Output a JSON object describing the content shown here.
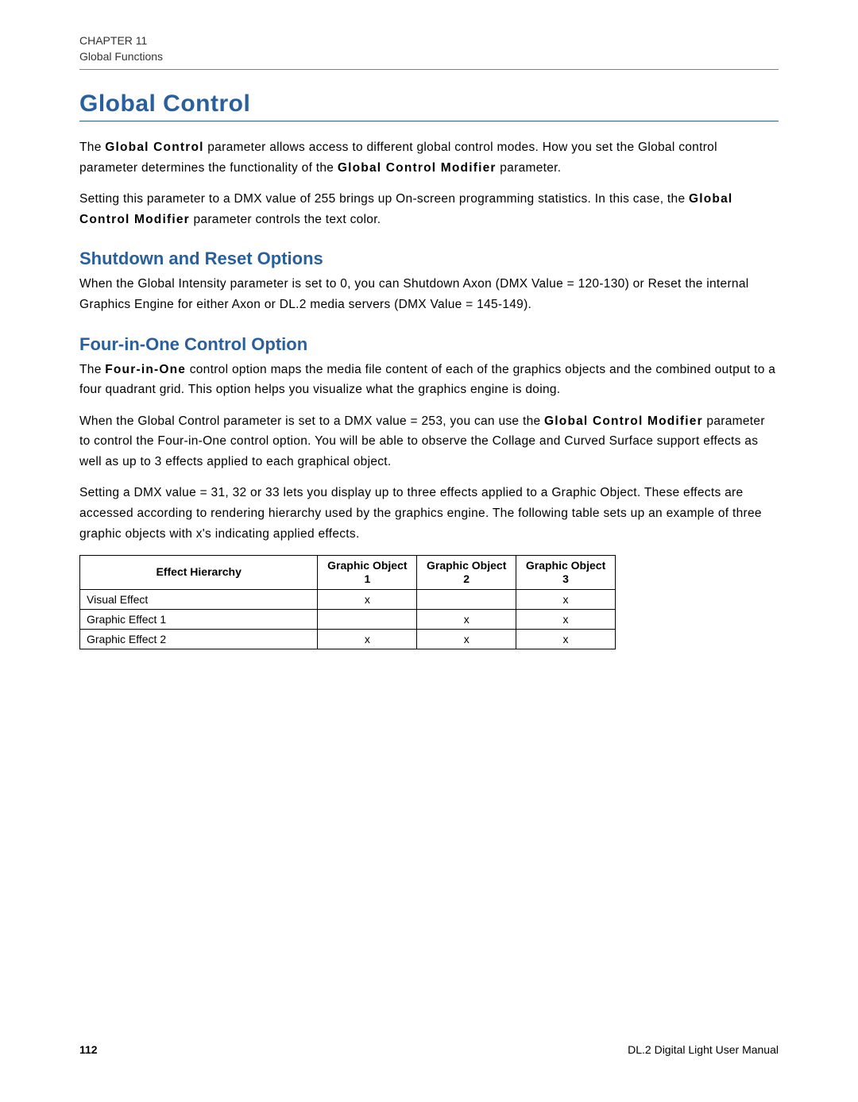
{
  "header": {
    "chapter": "CHAPTER 11",
    "section": "Global Functions"
  },
  "title": "Global Control",
  "intro_p1_pre": "The ",
  "intro_p1_bold1": "Global Control",
  "intro_p1_mid": " parameter allows access to different global control modes. How you set the Global control parameter determines the functionality of the ",
  "intro_p1_bold2": "Global Control Modifier",
  "intro_p1_post": " parameter.",
  "intro_p2_pre": "Setting this parameter to a DMX value of 255 brings up On-screen programming statistics. In this case, the ",
  "intro_p2_bold": "Global Control Modifier",
  "intro_p2_post": " parameter controls the text color.",
  "shutdown": {
    "title": "Shutdown and Reset Options",
    "text": "When the Global Intensity parameter is set to 0, you can Shutdown Axon (DMX Value = 120-130) or Reset the internal Graphics Engine for either Axon or DL.2 media servers (DMX Value = 145-149)."
  },
  "fourinone": {
    "title": "Four-in-One Control Option",
    "p1_pre": "The ",
    "p1_bold": "Four-in-One",
    "p1_post": " control option maps the media file content of each of the graphics objects and the combined output to a four quadrant grid. This option helps you visualize what the graphics engine is doing.",
    "p2_pre": "When the Global Control parameter is set to a DMX value = 253, you can use the ",
    "p2_bold": "Global Control Modifier",
    "p2_post": " parameter to control the Four-in-One control option. You will be able to observe the Collage and Curved Surface support effects as well as up to 3 effects applied to each graphical object.",
    "p3": "Setting a DMX value = 31, 32 or 33 lets you display up to three effects applied to a Graphic Object. These effects are accessed according to rendering hierarchy used by the graphics engine. The following table sets up an example of three graphic objects with x's indicating applied effects."
  },
  "table": {
    "headers": [
      "Effect Hierarchy",
      "Graphic Object 1",
      "Graphic Object 2",
      "Graphic Object 3"
    ],
    "rows": [
      {
        "label": "Visual Effect",
        "c1": "x",
        "c2": "",
        "c3": "x"
      },
      {
        "label": "Graphic Effect 1",
        "c1": "",
        "c2": "x",
        "c3": "x"
      },
      {
        "label": "Graphic Effect 2",
        "c1": "x",
        "c2": "x",
        "c3": "x"
      }
    ]
  },
  "footer": {
    "page": "112",
    "manual": "DL.2 Digital Light User Manual"
  }
}
